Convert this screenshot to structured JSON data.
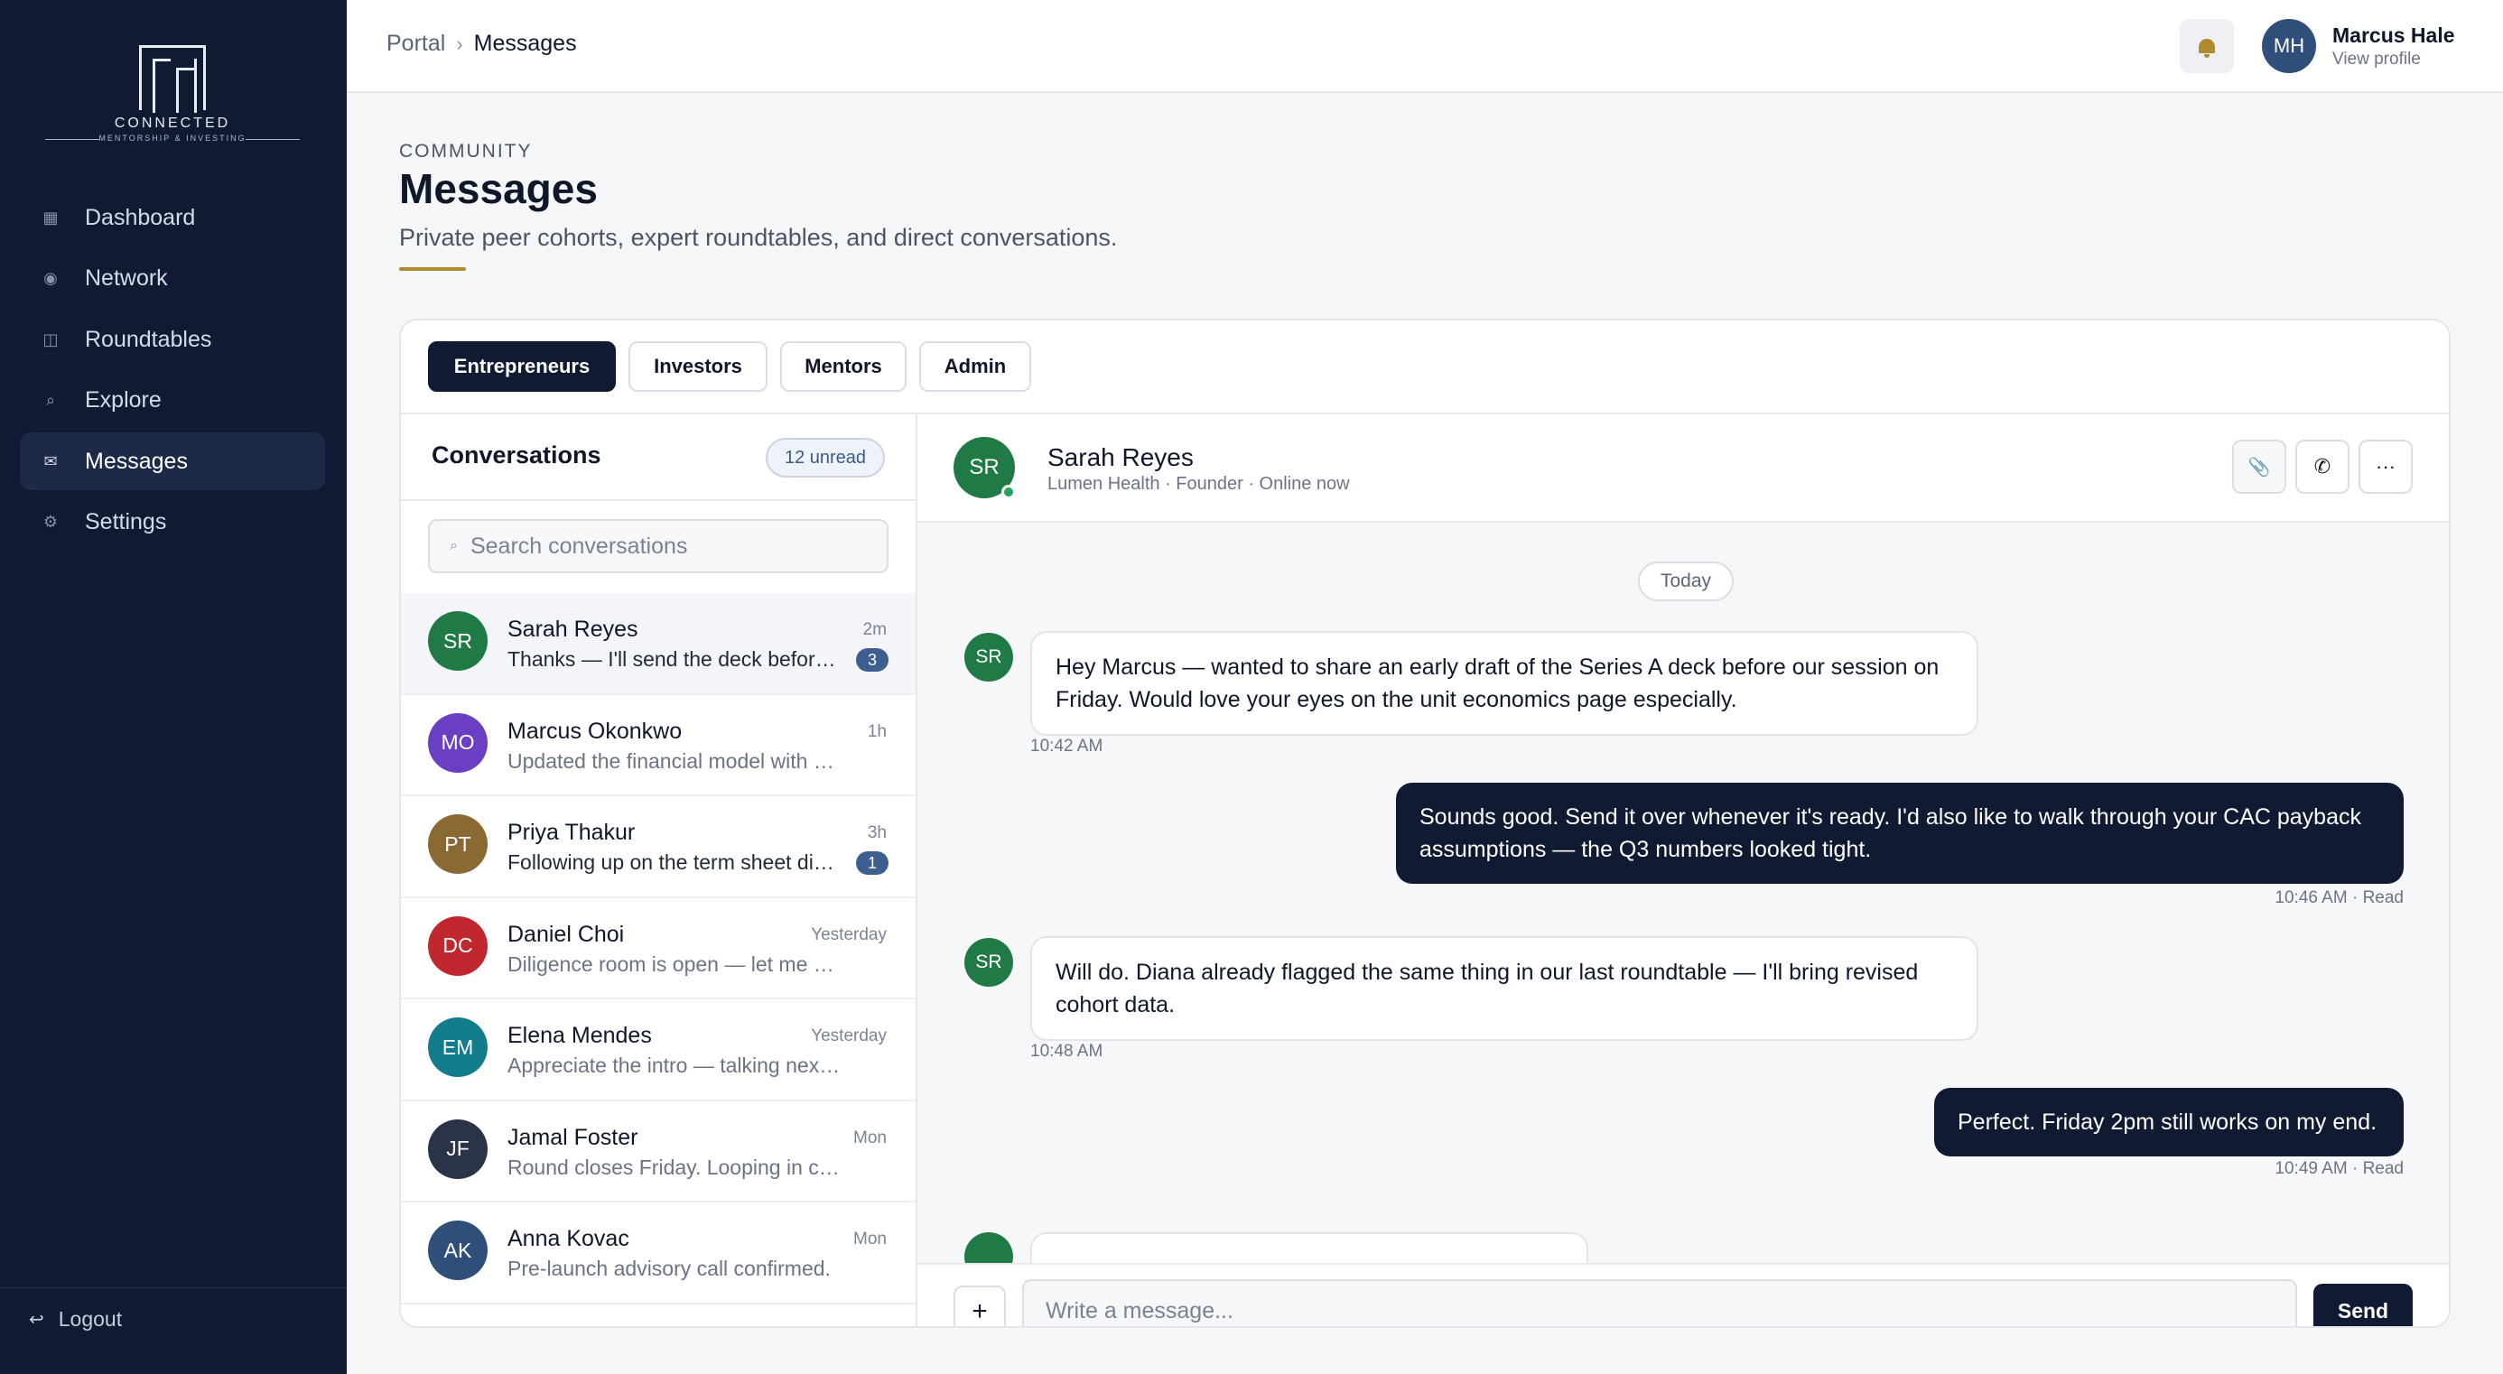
{
  "brand": {
    "name": "CONNECTED",
    "tagline": "MENTORSHIP & INVESTING",
    "mark": "CM"
  },
  "sidebar": {
    "items": [
      {
        "label": "Dashboard",
        "icon": "dashboard-icon",
        "glyph": "▦"
      },
      {
        "label": "Network",
        "icon": "network-icon",
        "glyph": "◉"
      },
      {
        "label": "Roundtables",
        "icon": "roundtables-icon",
        "glyph": "◫"
      },
      {
        "label": "Explore",
        "icon": "explore-icon",
        "glyph": "⌕"
      },
      {
        "label": "Messages",
        "icon": "messages-icon",
        "glyph": "✉",
        "active": true
      },
      {
        "label": "Settings",
        "icon": "settings-icon",
        "glyph": "⚙"
      }
    ],
    "logout": {
      "label": "Logout",
      "glyph": "↩"
    }
  },
  "topbar": {
    "breadcrumb": {
      "root": "Portal",
      "separator": "›",
      "current": "Messages"
    },
    "user": {
      "initials": "MH",
      "name": "Marcus Hale",
      "link": "View profile"
    }
  },
  "header": {
    "eyebrow": "COMMUNITY",
    "title": "Messages",
    "subtitle": "Private peer cohorts, expert roundtables, and direct conversations."
  },
  "tabs": [
    {
      "label": "Entrepreneurs",
      "active": true
    },
    {
      "label": "Investors"
    },
    {
      "label": "Mentors"
    },
    {
      "label": "Admin"
    }
  ],
  "conversations": {
    "title": "Conversations",
    "unread_label": "12 unread",
    "search_placeholder": "Search conversations",
    "items": [
      {
        "initials": "SR",
        "name": "Sarah Reyes",
        "preview": "Thanks — I'll send the deck before Friday.",
        "time": "2m",
        "badge": "3",
        "color": "#1f7a45",
        "active": true
      },
      {
        "initials": "MO",
        "name": "Marcus Okonkwo",
        "preview": "Updated the financial model with new assumptions.",
        "time": "1h",
        "color": "#6b3fc4"
      },
      {
        "initials": "PT",
        "name": "Priya Thakur",
        "preview": "Following up on the term sheet discussion.",
        "time": "3h",
        "badge": "1",
        "color": "#8a6a32"
      },
      {
        "initials": "DC",
        "name": "Daniel Choi",
        "preview": "Diligence room is open — let me know.",
        "time": "Yesterday",
        "color": "#c0282e"
      },
      {
        "initials": "EM",
        "name": "Elena Mendes",
        "preview": "Appreciate the intro — talking next week.",
        "time": "Yesterday",
        "color": "#127c8c"
      },
      {
        "initials": "JF",
        "name": "Jamal Foster",
        "preview": "Round closes Friday. Looping in counsel.",
        "time": "Mon",
        "color": "#2a3348"
      },
      {
        "initials": "AK",
        "name": "Anna Kovac",
        "preview": "Pre-launch advisory call confirmed.",
        "time": "Mon",
        "color": "#2f4f7a"
      }
    ]
  },
  "chat": {
    "contact": {
      "initials": "SR",
      "name": "Sarah Reyes",
      "meta": "Lumen Health · Founder · Online now"
    },
    "actions": [
      {
        "name": "attach-button",
        "icon": "paperclip-icon",
        "glyph": "📎"
      },
      {
        "name": "call-button",
        "icon": "phone-icon",
        "glyph": "✆"
      },
      {
        "name": "more-button",
        "icon": "ellipsis-icon",
        "glyph": "···"
      }
    ],
    "day_label": "Today",
    "messages": [
      {
        "dir": "in",
        "initials": "SR",
        "text": "Hey Marcus — wanted to share an early draft of the Series A deck before our session on Friday. Would love your eyes on the unit economics page especially.",
        "time": "10:42 AM"
      },
      {
        "dir": "out",
        "text": "Sounds good. Send it over whenever it's ready. I'd also like to walk through your CAC payback assumptions — the Q3 numbers looked tight.",
        "time": "10:46 AM · Read"
      },
      {
        "dir": "in",
        "initials": "SR",
        "text": "Will do. Diana already flagged the same thing in our last roundtable — I'll bring revised cohort data.",
        "time": "10:48 AM"
      },
      {
        "dir": "out",
        "text": "Perfect. Friday 2pm still works on my end.",
        "time": "10:49 AM · Read"
      }
    ],
    "composer": {
      "placeholder": "Write a message...",
      "plus": "+",
      "send": "Send"
    }
  },
  "colors": {
    "sidebar": "#101a33",
    "accent": "#b08a2e",
    "primary": "#101a33",
    "online": "#22a559"
  }
}
